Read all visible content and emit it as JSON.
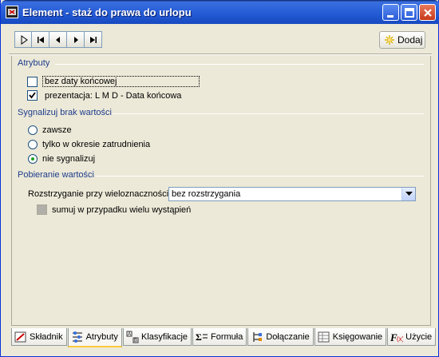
{
  "window": {
    "title": "Element - staż do prawa do urlopu"
  },
  "toolbar": {
    "nav_icons": [
      "first-record-icon",
      "prev-record-icon",
      "next-record-icon",
      "last-record-icon"
    ],
    "add_label": "Dodaj"
  },
  "attributes": {
    "section_label": "Atrybuty",
    "no_end_date_label": "bez daty końcowej",
    "no_end_date_checked": false,
    "presentation_label": "prezentacja: L M D - Data końcowa",
    "presentation_checked": true
  },
  "signal": {
    "section_label": "Sygnalizuj brak wartości",
    "options": [
      "zawsze",
      "tylko w okresie zatrudnienia",
      "nie sygnalizuj"
    ],
    "selected": "nie sygnalizuj"
  },
  "retrieval": {
    "section_label": "Pobieranie wartości",
    "ambiguity_label": "Rozstrzyganie przy wieloznaczności:",
    "ambiguity_value": "bez rozstrzygania",
    "sum_label": "sumuj w przypadku wielu wystąpień"
  },
  "tabs": [
    {
      "label": "Składnik",
      "icon": "component-icon"
    },
    {
      "label": "Atrybuty",
      "icon": "attributes-icon",
      "active": true
    },
    {
      "label": "Klasyfikacje",
      "icon": "classification-icon"
    },
    {
      "label": "Formuła",
      "icon": "formula-icon"
    },
    {
      "label": "Dołączanie",
      "icon": "attach-icon"
    },
    {
      "label": "Księgowanie",
      "icon": "ledger-icon"
    },
    {
      "label": "Użycie",
      "icon": "function-icon"
    }
  ],
  "colors": {
    "title_bar": "#2C62D9",
    "section_text": "#1E3C8C",
    "active_tab_accent": "#FFC83C",
    "radio_dot": "#21A121"
  }
}
